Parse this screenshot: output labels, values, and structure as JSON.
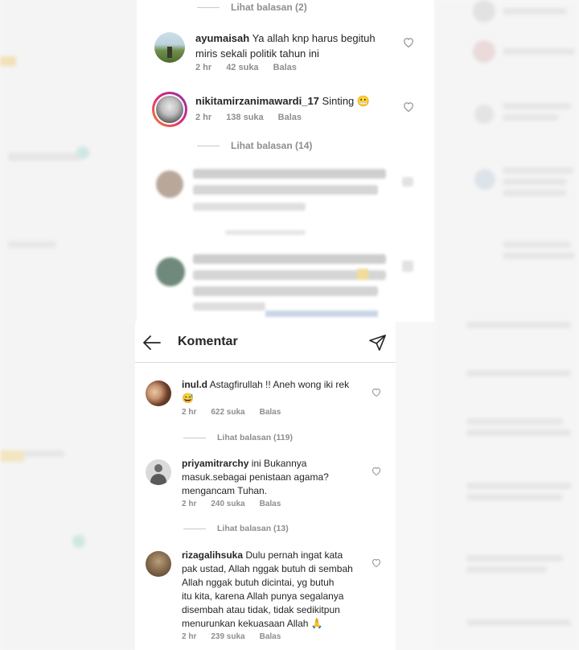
{
  "top": {
    "replies1": "Lihat balasan (2)",
    "comments": [
      {
        "username": "ayumaisah",
        "text_line1": "Ya allah knp harus begituh",
        "text_line2": "miris sekali politik tahun ini",
        "time": "2 hr",
        "likes": "42 suka",
        "reply": "Balas"
      },
      {
        "username": "nikitamirzanimawardi_17",
        "text": "Sinting",
        "emoji": "😬",
        "time": "2 hr",
        "likes": "138 suka",
        "reply": "Balas"
      }
    ],
    "replies2": "Lihat balasan (14)"
  },
  "header": {
    "title": "Komentar",
    "back_icon": "arrow-left-icon",
    "send_icon": "paper-plane-icon"
  },
  "bottom": {
    "comments": [
      {
        "username": "inul.d",
        "text_line1": "Astagfirullah !! Aneh wong iki rek",
        "emoji": "😅",
        "time": "2 hr",
        "likes": "622 suka",
        "reply": "Balas",
        "replies": "Lihat balasan (119)"
      },
      {
        "username": "priyamitrarchy",
        "text_line1": "ini Bukannya",
        "text_line2": "masuk.sebagai penistaan agama?",
        "text_line3": "mengancam Tuhan.",
        "time": "2 hr",
        "likes": "240 suka",
        "reply": "Balas",
        "replies": "Lihat balasan (13)"
      },
      {
        "username": "rizagalihsuka",
        "text_line1": "Dulu pernah ingat kata",
        "text_line2": "pak ustad, Allah nggak butuh di sembah",
        "text_line3": "Allah nggak butuh dicintai, yg butuh",
        "text_line4": "itu kita, karena Allah punya segalanya",
        "text_line5": "disembah atau tidak, tidak sedikitpun",
        "text_line6": "menurunkan kekuasaan Allah",
        "emoji": "🙏",
        "time": "2 hr",
        "likes": "239 suka",
        "reply": "Balas"
      }
    ]
  },
  "colors": {
    "text": "#262626",
    "muted": "#8e8e8e",
    "divider": "#dbdbdb",
    "story_ring": "#c13584"
  }
}
